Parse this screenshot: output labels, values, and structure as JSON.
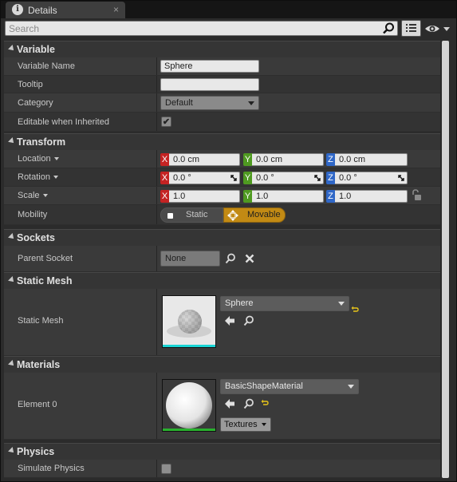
{
  "tab": {
    "title": "Details",
    "icon": "info-icon",
    "close": "×"
  },
  "search": {
    "placeholder": "Search",
    "value": ""
  },
  "toolbar": {
    "view_options_icon": "list-view-icon",
    "visibility_icon": "eye-icon"
  },
  "sections": {
    "variable": {
      "title": "Variable",
      "rows": {
        "variable_name": {
          "label": "Variable Name",
          "value": "Sphere"
        },
        "tooltip": {
          "label": "Tooltip",
          "value": ""
        },
        "category": {
          "label": "Category",
          "value": "Default"
        },
        "editable": {
          "label": "Editable when Inherited",
          "checked": true,
          "check_glyph": "✔"
        }
      }
    },
    "transform": {
      "title": "Transform",
      "location": {
        "label": "Location",
        "x": "0.0 cm",
        "y": "0.0 cm",
        "z": "0.0 cm"
      },
      "rotation": {
        "label": "Rotation",
        "x": "0.0 °",
        "y": "0.0 °",
        "z": "0.0 °"
      },
      "scale": {
        "label": "Scale",
        "x": "1.0",
        "y": "1.0",
        "z": "1.0"
      },
      "axis_labels": {
        "x": "X",
        "y": "Y",
        "z": "Z"
      },
      "mobility": {
        "label": "Mobility",
        "options": [
          "Static",
          "Movable"
        ],
        "selected": "Movable"
      }
    },
    "sockets": {
      "title": "Sockets",
      "parent_socket": {
        "label": "Parent Socket",
        "value": "None"
      }
    },
    "static_mesh": {
      "title": "Static Mesh",
      "row": {
        "label": "Static Mesh",
        "value": "Sphere"
      }
    },
    "materials": {
      "title": "Materials",
      "row": {
        "label": "Element 0",
        "value": "BasicShapeMaterial",
        "textures_button": "Textures"
      }
    },
    "physics": {
      "title": "Physics",
      "simulate": {
        "label": "Simulate Physics",
        "checked": false
      }
    }
  },
  "colors": {
    "axis_x": "#c42323",
    "axis_y": "#4f9a21",
    "axis_z": "#2f67c7",
    "movable_highlight": "#c28a14",
    "mesh_thumb_bar": "#18d4d4",
    "material_thumb_bar": "#29b12e"
  }
}
